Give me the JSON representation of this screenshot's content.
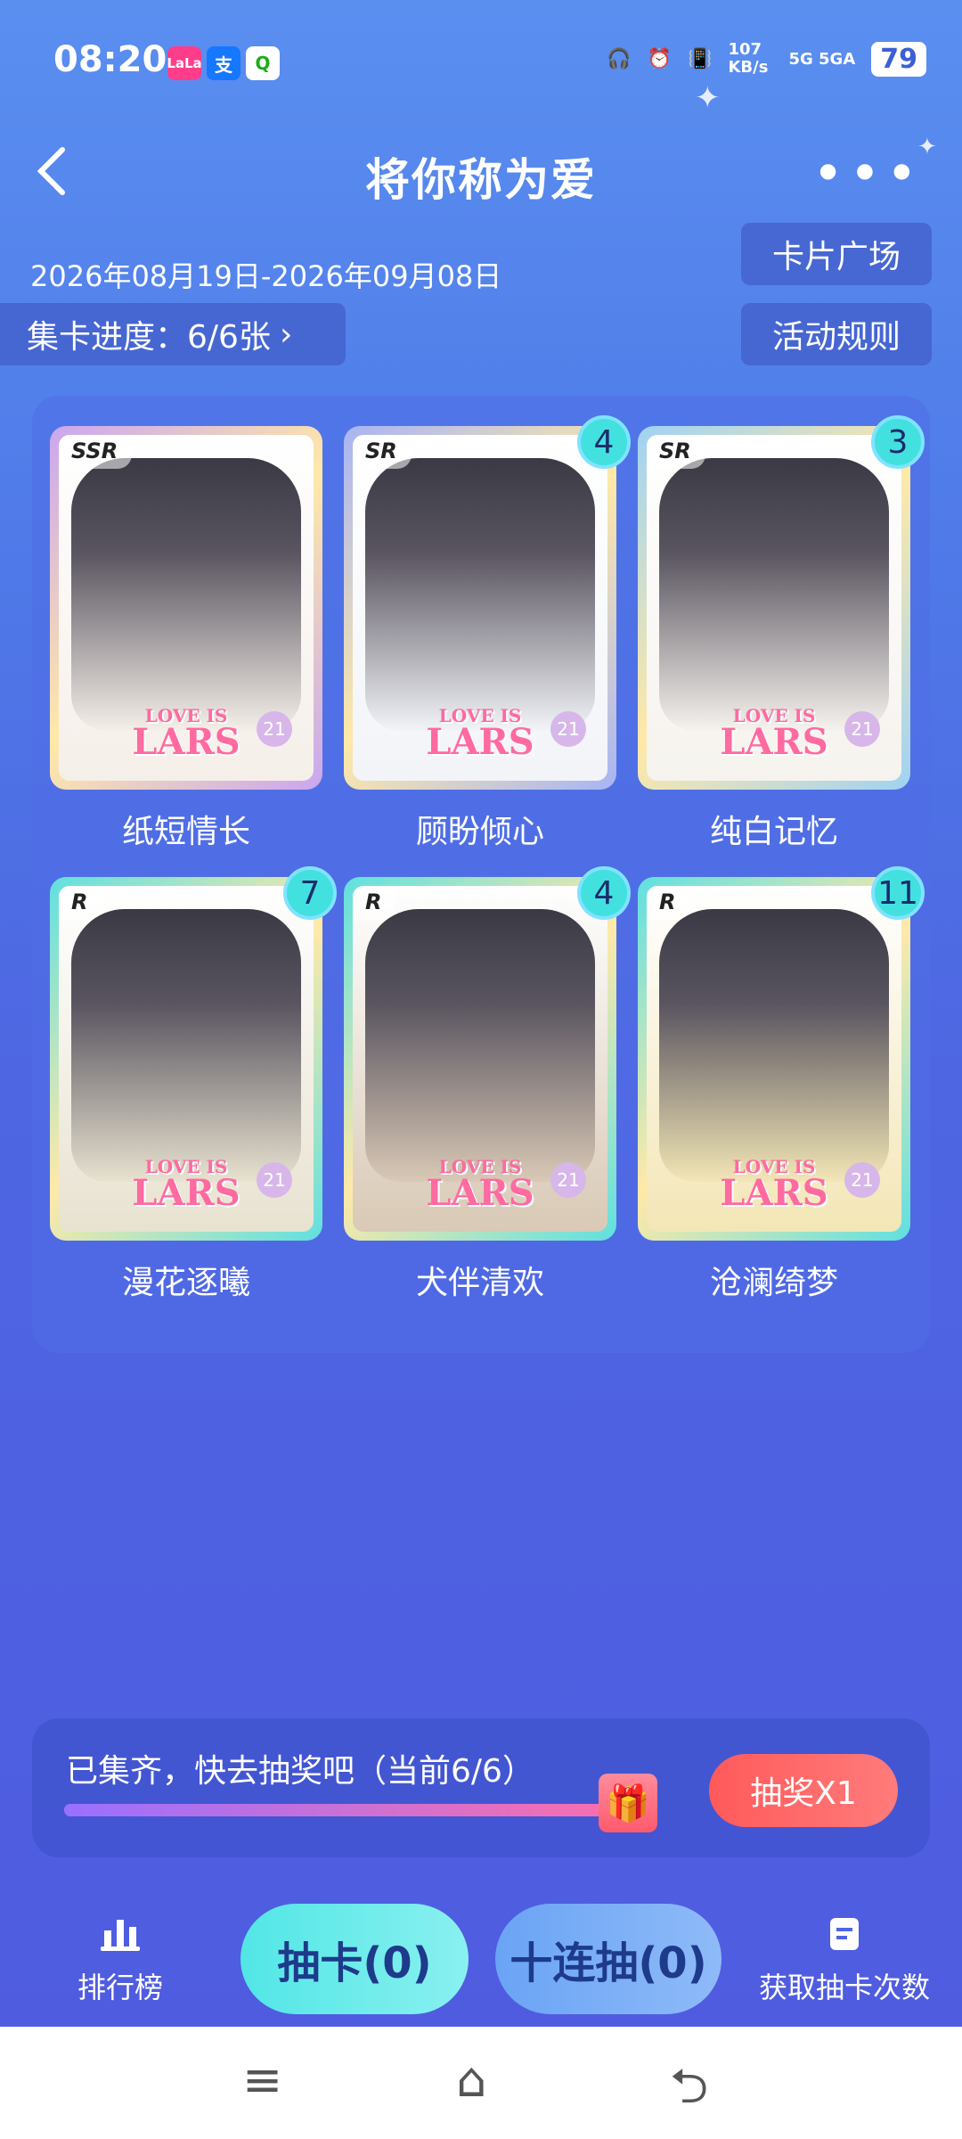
{
  "status_bar": {
    "time": "08:20",
    "apps": [
      "LaLa",
      "支",
      "Q"
    ],
    "speed": "107 KB/s",
    "signal": "5G 5GA",
    "battery": "79"
  },
  "header": {
    "back_icon": "chevron-left-icon",
    "title": "将你称为爱",
    "more_icon": "more-dots-icon"
  },
  "activity": {
    "dates": "2026年08月19日-2026年09月08日",
    "progress_label": "集卡进度：6/6张",
    "card_plaza": "卡片广场",
    "rules": "活动规则"
  },
  "cards": [
    {
      "rarity": "SSR",
      "count": "",
      "name": "纸短情长",
      "frame": "#c9a6f0",
      "bg": "#f5efe9"
    },
    {
      "rarity": "SR",
      "count": "4",
      "name": "顾盼倾心",
      "frame": "#a7b4f5",
      "bg": "#f2f4f8"
    },
    {
      "rarity": "SR",
      "count": "3",
      "name": "纯白记忆",
      "frame": "#9fd2f4",
      "bg": "#f6f3ee"
    },
    {
      "rarity": "R",
      "count": "7",
      "name": "漫花逐曦",
      "frame": "#5fe0e0",
      "bg": "#e8e2d0"
    },
    {
      "rarity": "R",
      "count": "4",
      "name": "犬伴清欢",
      "frame": "#5fe0e0",
      "bg": "#d9c9b6"
    },
    {
      "rarity": "R",
      "count": "11",
      "name": "沧澜绮梦",
      "frame": "#5fe0e0",
      "bg": "#f3e6b6"
    }
  ],
  "card_logo": {
    "small": "LOVE IS",
    "big": "LARS",
    "num": "21"
  },
  "lottery": {
    "text": "已集齐，快去抽奖吧（当前6/6）",
    "progress": 1.0,
    "button": "抽奖X1"
  },
  "bottom": {
    "ranking": "排行榜",
    "draw": "抽卡(0)",
    "draw_ten": "十连抽(0)",
    "get_chances": "获取抽卡次数"
  },
  "colors": {
    "accent": "#43e0e0",
    "lottery_btn": "#ff5a5a"
  }
}
